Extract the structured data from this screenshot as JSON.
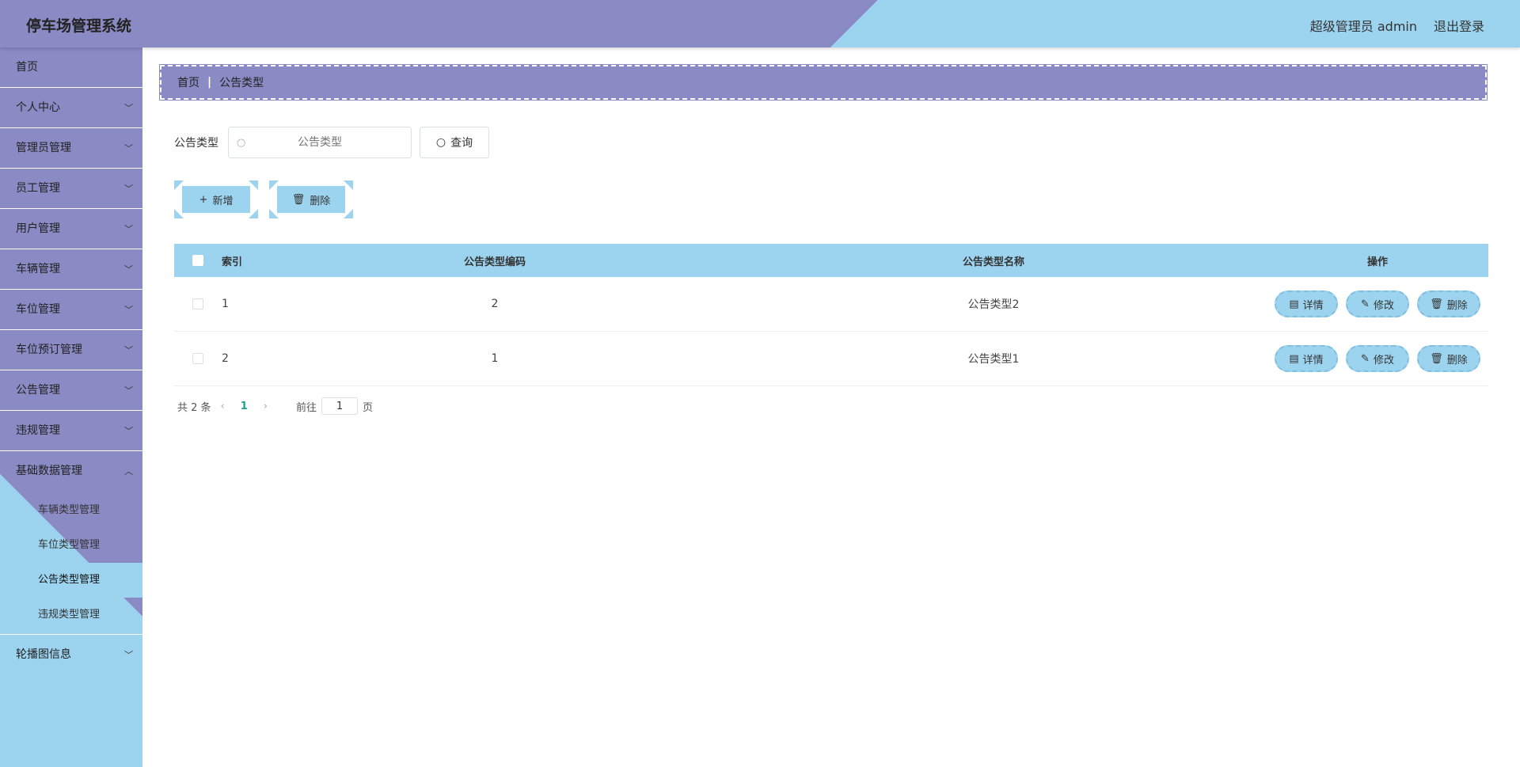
{
  "header": {
    "title": "停车场管理系统",
    "user": "超级管理员 admin",
    "logout": "退出登录"
  },
  "sidebar": {
    "items": [
      {
        "label": "首页"
      },
      {
        "label": "个人中心"
      },
      {
        "label": "管理员管理"
      },
      {
        "label": "员工管理"
      },
      {
        "label": "用户管理"
      },
      {
        "label": "车辆管理"
      },
      {
        "label": "车位管理"
      },
      {
        "label": "车位预订管理"
      },
      {
        "label": "公告管理"
      },
      {
        "label": "违规管理"
      },
      {
        "label": "基础数据管理"
      },
      {
        "label": "轮播图信息"
      }
    ],
    "sub_items": [
      {
        "label": "车辆类型管理"
      },
      {
        "label": "车位类型管理"
      },
      {
        "label": "公告类型管理"
      },
      {
        "label": "违规类型管理"
      }
    ]
  },
  "breadcrumb": {
    "home": "首页",
    "current": "公告类型"
  },
  "search": {
    "label": "公告类型",
    "placeholder": "公告类型",
    "button": "查询"
  },
  "actions": {
    "add": "新增",
    "delete": "删除"
  },
  "table": {
    "headers": {
      "index": "索引",
      "code": "公告类型编码",
      "name": "公告类型名称",
      "ops": "操作"
    },
    "rows": [
      {
        "index": "1",
        "code": "2",
        "name": "公告类型2"
      },
      {
        "index": "2",
        "code": "1",
        "name": "公告类型1"
      }
    ],
    "ops": {
      "detail": "详情",
      "edit": "修改",
      "delete": "删除"
    }
  },
  "pager": {
    "total": "共 2 条",
    "current_page": "1",
    "goto_label": "前往",
    "goto_value": "1",
    "page_suffix": "页"
  },
  "colors": {
    "purple": "#8a8ac4",
    "blue": "#9cd3ee",
    "active_page": "#1aa094"
  }
}
